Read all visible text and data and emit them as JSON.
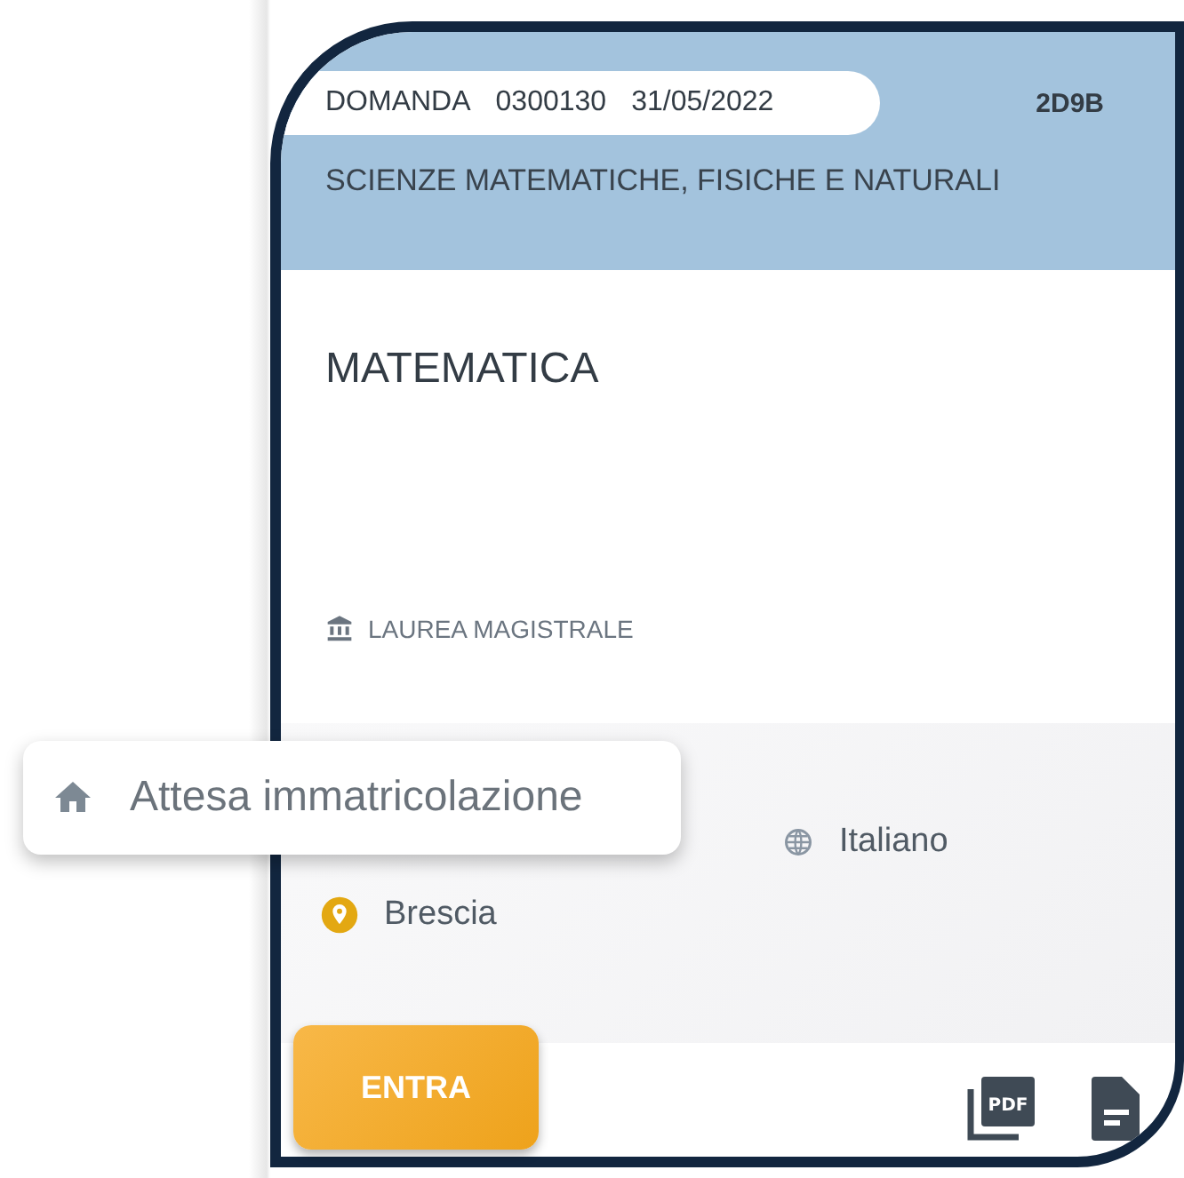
{
  "card": {
    "request_label": "DOMANDA",
    "request_number": "0300130",
    "request_date": "31/05/2022",
    "code": "2D9B",
    "faculty": "SCIENZE MATEMATICHE, FISICHE E NATURALI",
    "course": "MATEMATICA",
    "degree_type": "LAUREA MAGISTRALE",
    "language": "Italiano",
    "location": "Brescia",
    "pdf_label": "PDF"
  },
  "status_popup": {
    "label": "Attesa immatricolazione"
  },
  "enter_button": {
    "label": "ENTRA"
  }
}
